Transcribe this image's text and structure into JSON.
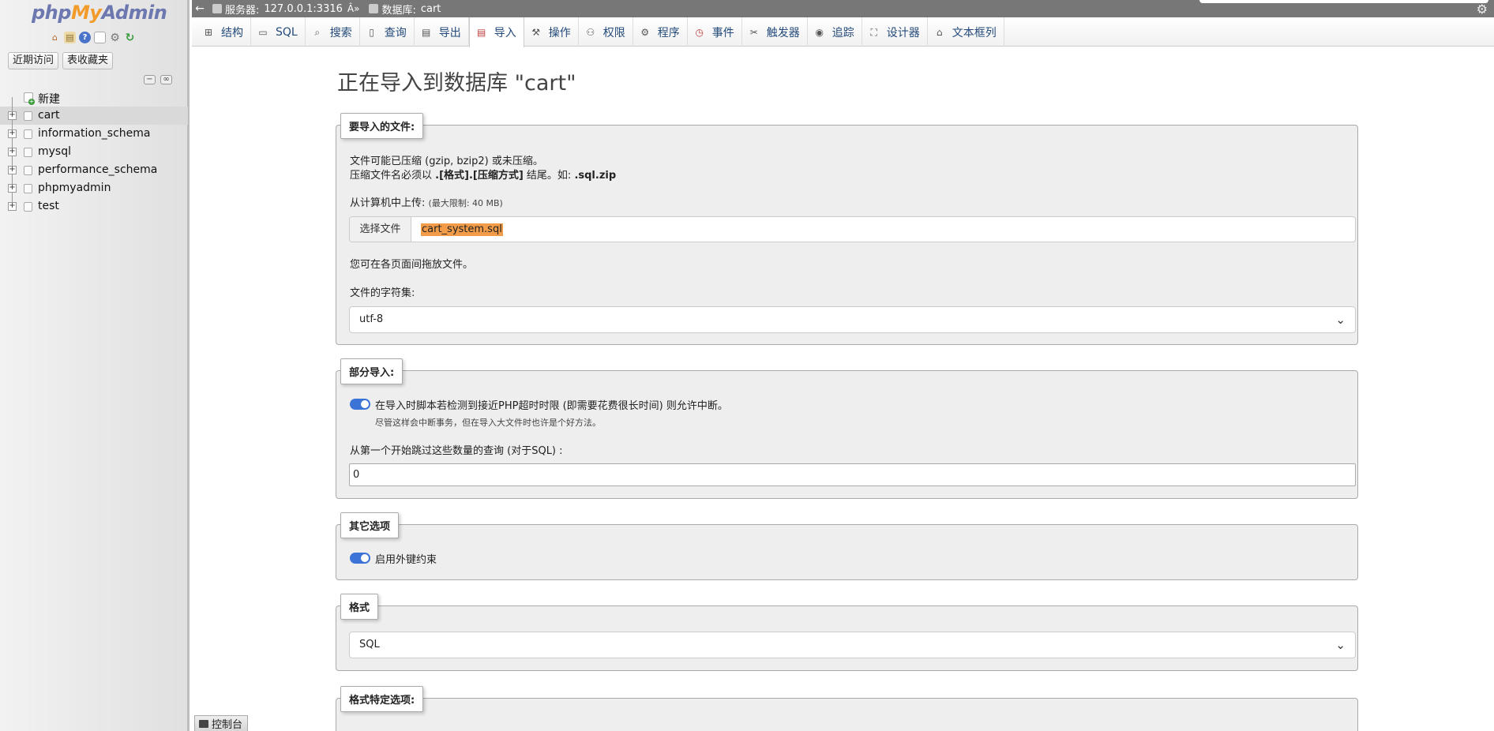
{
  "sidebar": {
    "logo_php": "php",
    "logo_my": "My",
    "logo_admin": "Admin",
    "recent_label": "近期访问",
    "favorites_label": "表收藏夹",
    "tree": [
      {
        "label": "新建",
        "icon": "new-db-icon"
      },
      {
        "label": "cart",
        "icon": "database-icon",
        "active": true
      },
      {
        "label": "information_schema",
        "icon": "database-icon"
      },
      {
        "label": "mysql",
        "icon": "database-icon"
      },
      {
        "label": "performance_schema",
        "icon": "database-icon"
      },
      {
        "label": "phpmyadmin",
        "icon": "database-icon"
      },
      {
        "label": "test",
        "icon": "database-icon"
      }
    ],
    "console_label": "控制台"
  },
  "breadcrumb": {
    "server_label": "服务器:",
    "server_value": "127.0.0.1:3316",
    "separator": "Â»",
    "database_label": "数据库:",
    "database_value": "cart"
  },
  "tabs": [
    {
      "label": "结构",
      "icon": "structure-icon"
    },
    {
      "label": "SQL",
      "icon": "sql-icon"
    },
    {
      "label": "搜索",
      "icon": "search-icon"
    },
    {
      "label": "查询",
      "icon": "query-icon"
    },
    {
      "label": "导出",
      "icon": "export-icon"
    },
    {
      "label": "导入",
      "icon": "import-icon",
      "active": true
    },
    {
      "label": "操作",
      "icon": "wrench-icon"
    },
    {
      "label": "权限",
      "icon": "privileges-icon"
    },
    {
      "label": "程序",
      "icon": "routines-icon"
    },
    {
      "label": "事件",
      "icon": "clock-icon"
    },
    {
      "label": "触发器",
      "icon": "triggers-icon"
    },
    {
      "label": "追踪",
      "icon": "eye-icon"
    },
    {
      "label": "设计器",
      "icon": "designer-icon"
    },
    {
      "label": "文本框列",
      "icon": "columns-icon"
    }
  ],
  "main": {
    "title": "正在导入到数据库 \"cart\"",
    "file_section": {
      "legend": "要导入的文件:",
      "line1": "文件可能已压缩 (gzip, bzip2) 或未压缩。",
      "line2_prefix": "压缩文件名必须以 ",
      "line2_bold": ".[格式].[压缩方式]",
      "line2_mid": " 结尾。如: ",
      "line2_example": ".sql.zip",
      "upload_label": "从计算机中上传:",
      "upload_limit": "(最大限制: 40 MB)",
      "choose_file_label": "选择文件",
      "file_name": "cart_system.sql",
      "drag_hint": "您可在各页面间拖放文件。",
      "charset_label": "文件的字符集:",
      "charset_value": "utf-8"
    },
    "partial_section": {
      "legend": "部分导入:",
      "interrupt_label": "在导入时脚本若检测到接近PHP超时时限 (即需要花费很长时间) 则允许中断。",
      "interrupt_hint": "尽管这样会中断事务，但在导入大文件时也许是个好方法。",
      "skip_label": "从第一个开始跳过这些数量的查询 (对于SQL) :",
      "skip_value": "0"
    },
    "other_section": {
      "legend": "其它选项",
      "fk_label": "启用外键约束"
    },
    "format_section": {
      "legend": "格式",
      "format_value": "SQL"
    },
    "format_options_section": {
      "legend": "格式特定选项:"
    }
  },
  "colors": {
    "accent": "#3b74d6",
    "file_highlight": "#f29b48",
    "logo_blue": "#6c78af",
    "logo_orange": "#f29b2a"
  }
}
